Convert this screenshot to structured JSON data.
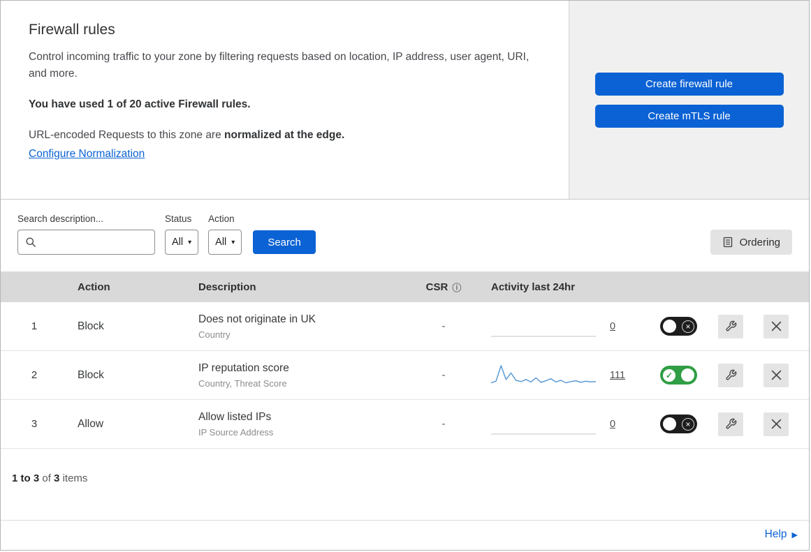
{
  "colors": {
    "accent_blue": "#0b62d4",
    "toggle_on_green": "#2f9e44",
    "sparkline_blue": "#5b9bd5",
    "table_header_bg": "#d9d9d9"
  },
  "header": {
    "title": "Firewall rules",
    "description": "Control incoming traffic to your zone by filtering requests based on location, IP address, user agent, URI, and more.",
    "usage": "You have used 1 of 20 active Firewall rules.",
    "normalization_prefix": "URL-encoded Requests to this zone are ",
    "normalization_bold": "normalized at the edge.",
    "normalization_link": "Configure Normalization",
    "create_firewall_button": "Create firewall rule",
    "create_mtls_button": "Create mTLS rule"
  },
  "filters": {
    "search_label": "Search description...",
    "status_label": "Status",
    "status_value": "All",
    "action_label": "Action",
    "action_value": "All",
    "search_button": "Search",
    "ordering_button": "Ordering"
  },
  "table": {
    "headers": {
      "action": "Action",
      "description": "Description",
      "csr": "CSR",
      "activity": "Activity last 24hr"
    },
    "rows": [
      {
        "index": "1",
        "action": "Block",
        "description": "Does not originate in UK",
        "subtext": "Country",
        "csr": "-",
        "activity_count": "0",
        "enabled": false,
        "sparkline": []
      },
      {
        "index": "2",
        "action": "Block",
        "description": "IP reputation score",
        "subtext": "Country, Threat Score",
        "csr": "-",
        "activity_count": "111",
        "enabled": true,
        "sparkline": [
          6,
          10,
          48,
          14,
          30,
          12,
          9,
          14,
          8,
          18,
          7,
          11,
          16,
          8,
          12,
          6,
          9,
          11,
          7,
          10,
          8,
          9
        ]
      },
      {
        "index": "3",
        "action": "Allow",
        "description": "Allow listed IPs",
        "subtext": "IP Source Address",
        "csr": "-",
        "activity_count": "0",
        "enabled": false,
        "sparkline": []
      }
    ]
  },
  "footer": {
    "range": "1 to 3",
    "of": "of",
    "total": "3",
    "items": "items",
    "help": "Help"
  }
}
